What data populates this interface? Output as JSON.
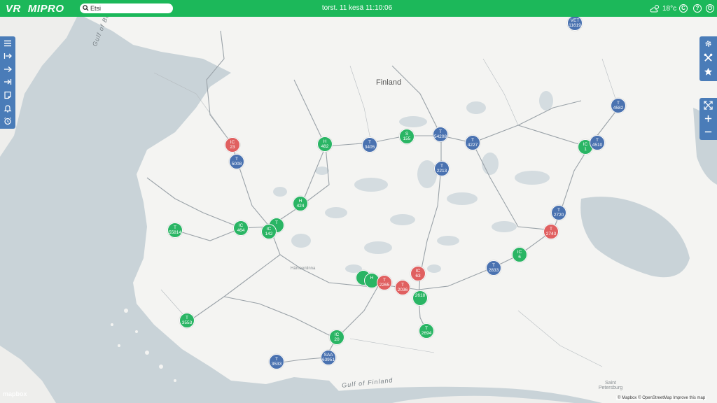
{
  "header": {
    "logo_vr": "VR",
    "logo_name": "MIPRO",
    "search_placeholder": "Etsi",
    "clock": "torst. 11 kesä 11:10:06",
    "temperature": "18°c",
    "icons": [
      "search-icon",
      "weather-icon",
      "copyright-icon",
      "help-icon",
      "power-icon"
    ]
  },
  "map": {
    "country_label": "Finland",
    "seas": [
      "Gulf of Bothnia",
      "Gulf of Finland"
    ],
    "places": [
      "Hämeenlinna",
      "Saint Petersburg"
    ],
    "colors": {
      "green": "#2ab564",
      "blue": "#4a72b0",
      "red": "#e06060",
      "land": "#f4f4f2",
      "water": "#c9d3d8",
      "road": "#9aa2a8"
    },
    "markers": [
      {
        "type": "VET",
        "num": "11619",
        "color": "blue"
      },
      {
        "type": "IC",
        "num": "23",
        "color": "red"
      },
      {
        "type": "T",
        "num": "5008",
        "color": "blue"
      },
      {
        "type": "H",
        "num": "482",
        "color": "green"
      },
      {
        "type": "T",
        "num": "3405",
        "color": "blue"
      },
      {
        "type": "S",
        "num": "155",
        "color": "green"
      },
      {
        "type": "T",
        "num": "54208",
        "color": "blue"
      },
      {
        "type": "T",
        "num": "4227",
        "color": "blue"
      },
      {
        "type": "T",
        "num": "2213",
        "color": "blue"
      },
      {
        "type": "T",
        "num": "4582",
        "color": "blue"
      },
      {
        "type": "IC",
        "num": "1",
        "color": "green"
      },
      {
        "type": "T",
        "num": "4510",
        "color": "blue"
      },
      {
        "type": "H",
        "num": "424",
        "color": "green"
      },
      {
        "type": "T",
        "num": "55814",
        "color": "green"
      },
      {
        "type": "IC",
        "num": "464",
        "color": "green"
      },
      {
        "type": "IC",
        "num": "142",
        "color": "green"
      },
      {
        "type": "T",
        "num": "",
        "color": "green"
      },
      {
        "type": "T",
        "num": "2720",
        "color": "blue"
      },
      {
        "type": "T",
        "num": "2743",
        "color": "red"
      },
      {
        "type": "IC",
        "num": "6",
        "color": "green"
      },
      {
        "type": "T",
        "num": "2833",
        "color": "blue"
      },
      {
        "type": "IC",
        "num": "63",
        "color": "red"
      },
      {
        "type": "T",
        "num": "2036",
        "color": "red"
      },
      {
        "type": "T",
        "num": "2265",
        "color": "red"
      },
      {
        "type": "H",
        "num": "",
        "color": "green"
      },
      {
        "type": "",
        "num": "",
        "color": "green"
      },
      {
        "type": "",
        "num": "2618",
        "color": "green"
      },
      {
        "type": "T",
        "num": "3553",
        "color": "green"
      },
      {
        "type": "T",
        "num": "2694",
        "color": "green"
      },
      {
        "type": "IC",
        "num": "20",
        "color": "green"
      },
      {
        "type": "SAA",
        "num": "63951",
        "color": "blue"
      },
      {
        "type": "T",
        "num": "3533",
        "color": "blue"
      }
    ],
    "attribution": "© Mapbox © OpenStreetMap  Improve this map",
    "watermark": "mapbox"
  },
  "left_toolbar": [
    "menu-icon",
    "arrow-right-bar-icon",
    "arrow-right-icon",
    "arrow-to-bar-icon",
    "note-icon",
    "bell-icon",
    "alarm-clock-icon"
  ],
  "right_toolbar": [
    "gear-icon",
    "tools-icon",
    "star-icon",
    "fullscreen-icon",
    "zoom-in-icon",
    "zoom-out-icon"
  ]
}
